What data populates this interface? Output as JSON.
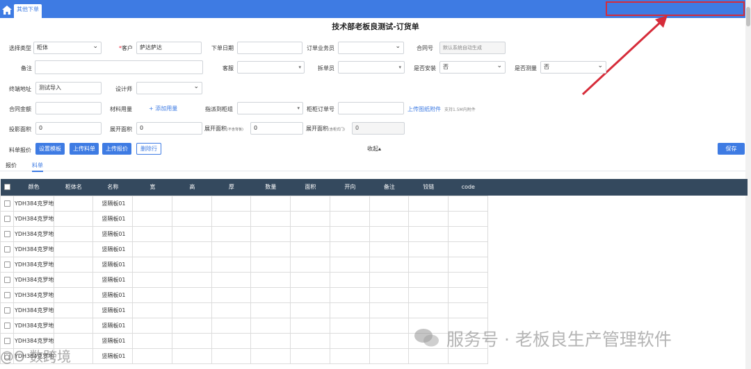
{
  "topbar": {
    "tab_label": "其他下单",
    "accent": "#3e7be3"
  },
  "page_title": "技术部老板良测试-订货单",
  "form": {
    "type_label": "选择类型",
    "type_value": "柜体",
    "customer_label": "客户",
    "customer_value": "萨达萨达",
    "order_date_label": "下单日期",
    "order_date_value": "",
    "salesman_label": "订单业务员",
    "salesman_value": "",
    "contract_label": "合同号",
    "contract_placeholder": "默认系统自动生成",
    "remark_label": "备注",
    "remark_value": "",
    "service_label": "客服",
    "service_value": "",
    "splitter_label": "拆单员",
    "splitter_value": "",
    "install_label": "是否安装",
    "install_value": "否",
    "measure_label": "是否测量",
    "measure_value": "否",
    "address_label": "终端地址",
    "address_value": "测试导入",
    "designer_label": "设计师",
    "designer_value": "",
    "amount_label": "合同金额",
    "amount_value": "",
    "material_label": "材料用量",
    "material_add": "+ 添加用量",
    "assign_label": "指派到柜组",
    "assign_value": "",
    "cabinet_order_label": "柜柜订单号",
    "cabinet_order_value": "",
    "upload_link": "上传图纸附件",
    "upload_hint": "支持1.5M内附件",
    "proj_area_label": "投影面积",
    "proj_area_value": "0",
    "unfold1_label": "展开面积",
    "unfold1_value": "0",
    "unfold2_label": "展开面积",
    "unfold2_note": "(不含背板)",
    "unfold2_value": "0",
    "unfold3_label": "展开面积",
    "unfold3_note": "(含柜式门)",
    "unfold3_value": "0"
  },
  "actions": {
    "quote_label": "料单报价",
    "set_template": "设置模板",
    "upload_list": "上传料单",
    "upload_quote": "上传报价",
    "delete_row": "删除行",
    "collapse": "收起▴",
    "save": "保存"
  },
  "tabs": [
    "报价",
    "料单"
  ],
  "table": {
    "columns": [
      "颜色",
      "柜体名",
      "名称",
      "宽",
      "高",
      "厚",
      "数量",
      "面积",
      "开向",
      "备注",
      "铰链",
      "code"
    ],
    "rows": [
      [
        "YDH384克罗地",
        "",
        "竖隔板01"
      ],
      [
        "YDH384克罗地",
        "",
        "竖隔板01"
      ],
      [
        "YDH384克罗地",
        "",
        "竖隔板01"
      ],
      [
        "YDH384克罗地",
        "",
        "竖隔板01"
      ],
      [
        "YDH384克罗地",
        "",
        "竖隔板01"
      ],
      [
        "YDH384克罗地",
        "",
        "竖隔板01"
      ],
      [
        "YDH384克罗地",
        "",
        "竖隔板01"
      ],
      [
        "YDH384克罗地",
        "",
        "竖隔板01"
      ],
      [
        "YDH384克罗地",
        "",
        "竖隔板01"
      ],
      [
        "YDH384克罗地",
        "",
        "竖隔板01"
      ],
      [
        "YDH384克罗地",
        "",
        "竖隔板01"
      ]
    ]
  },
  "watermark": {
    "text": "服务号 · 老板良生产管理软件",
    "text2": "@O 数跨境"
  }
}
